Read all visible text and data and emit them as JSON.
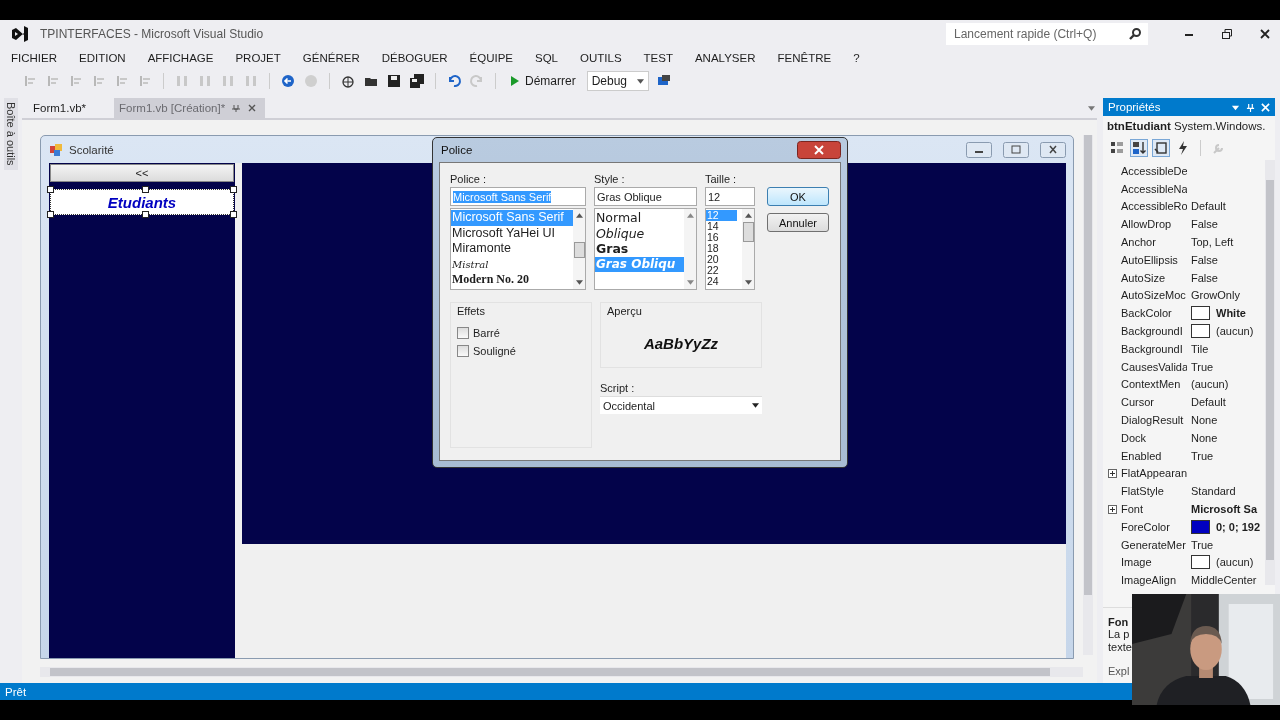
{
  "window": {
    "title": "TPINTERFACES - Microsoft Visual Studio",
    "quick_launch": {
      "placeholder": "Lancement rapide (Ctrl+Q)"
    }
  },
  "menu": [
    "FICHIER",
    "EDITION",
    "AFFICHAGE",
    "PROJET",
    "GÉNÉRER",
    "DÉBOGUER",
    "ÉQUIPE",
    "SQL",
    "OUTILS",
    "TEST",
    "ANALYSER",
    "FENÊTRE",
    "?"
  ],
  "toolbar": {
    "run_label": "Démarrer",
    "configuration": "Debug"
  },
  "toolbox_tab": "Boîte à outils",
  "document_tabs": [
    {
      "label": "Form1.vb*",
      "selected": false
    },
    {
      "label": "Form1.vb [Création]*",
      "selected": true
    }
  ],
  "form": {
    "title": "Scolarité",
    "buttons": [
      {
        "label": "<<",
        "selected": false
      },
      {
        "label": "Etudiants",
        "selected": true
      }
    ]
  },
  "font_dialog": {
    "title": "Police",
    "font": {
      "label": "Police :",
      "value": "Microsoft Sans Serif",
      "items": [
        {
          "label": "Microsoft Sans Serif",
          "kind": "sans",
          "selected": true
        },
        {
          "label": "Microsoft YaHei UI",
          "kind": "sans",
          "selected": false
        },
        {
          "label": "Miramonte",
          "kind": "sans",
          "selected": false
        },
        {
          "label": "Mistral",
          "kind": "script",
          "selected": false
        },
        {
          "label": "Modern No. 20",
          "kind": "serif",
          "selected": false
        }
      ]
    },
    "style": {
      "label": "Style :",
      "value": "Gras Oblique",
      "items": [
        {
          "label": "Normal",
          "kind": "normal",
          "selected": false
        },
        {
          "label": "Oblique",
          "kind": "italic",
          "selected": false
        },
        {
          "label": "Gras",
          "kind": "bold",
          "selected": false
        },
        {
          "label": "Gras Obliqu",
          "kind": "bolditalic",
          "selected": true
        }
      ]
    },
    "size": {
      "label": "Taille :",
      "value": "12",
      "items": [
        {
          "label": "12",
          "selected": true
        },
        {
          "label": "14",
          "selected": false
        },
        {
          "label": "16",
          "selected": false
        },
        {
          "label": "18",
          "selected": false
        },
        {
          "label": "20",
          "selected": false
        },
        {
          "label": "22",
          "selected": false
        },
        {
          "label": "24",
          "selected": false
        }
      ]
    },
    "effects": {
      "title": "Effets",
      "options": [
        {
          "label": "Barré",
          "checked": false
        },
        {
          "label": "Souligné",
          "checked": false
        }
      ]
    },
    "preview": {
      "title": "Aperçu",
      "sample": "AaBbYyZz"
    },
    "script": {
      "label": "Script :",
      "value": "Occidental"
    },
    "buttons": [
      "OK",
      "Annuler"
    ]
  },
  "properties": {
    "title": "Propriétés",
    "object_name": "btnEtudiant",
    "object_type": "System.Windows.",
    "rows": [
      {
        "name": "AccessibleDe",
        "expandable": false
      },
      {
        "name": "AccessibleNa",
        "expandable": false
      },
      {
        "name": "AccessibleRo",
        "value": "Default",
        "modified": false,
        "expandable": false
      },
      {
        "name": "AllowDrop",
        "value": "False",
        "modified": false,
        "expandable": false
      },
      {
        "name": "Anchor",
        "value": "Top, Left",
        "modified": false,
        "expandable": false
      },
      {
        "name": "AutoEllipsis",
        "value": "False",
        "modified": false,
        "expandable": false
      },
      {
        "name": "AutoSize",
        "value": "False",
        "modified": false,
        "expandable": false
      },
      {
        "name": "AutoSizeMoc",
        "value": "GrowOnly",
        "modified": false,
        "expandable": false
      },
      {
        "name": "BackColor",
        "value": "White",
        "color": "#ffffff",
        "modified": true,
        "expandable": false
      },
      {
        "name": "BackgroundI",
        "value": "(aucun)",
        "color": "#ffffff",
        "modified": false,
        "expandable": false
      },
      {
        "name": "BackgroundI",
        "value": "Tile",
        "modified": false,
        "expandable": false
      },
      {
        "name": "CausesValida",
        "value": "True",
        "modified": false,
        "expandable": false
      },
      {
        "name": "ContextMen",
        "value": "(aucun)",
        "modified": false,
        "expandable": false
      },
      {
        "name": "Cursor",
        "value": "Default",
        "modified": false,
        "expandable": false
      },
      {
        "name": "DialogResult",
        "value": "None",
        "modified": false,
        "expandable": false
      },
      {
        "name": "Dock",
        "value": "None",
        "modified": false,
        "expandable": false
      },
      {
        "name": "Enabled",
        "value": "True",
        "modified": false,
        "expandable": false
      },
      {
        "name": "FlatAppearan",
        "expandable": true
      },
      {
        "name": "FlatStyle",
        "value": "Standard",
        "modified": false,
        "expandable": false
      },
      {
        "name": "Font",
        "value": "Microsoft Sa",
        "modified": true,
        "expandable": true
      },
      {
        "name": "ForeColor",
        "value": "0; 0; 192",
        "color": "#0000c0",
        "modified": true,
        "expandable": false
      },
      {
        "name": "GenerateMer",
        "value": "True",
        "modified": false,
        "expandable": false
      },
      {
        "name": "Image",
        "value": "(aucun)",
        "color": "#ffffff",
        "modified": false,
        "expandable": false
      },
      {
        "name": "ImageAlign",
        "value": "MiddleCenter",
        "modified": false,
        "expandable": false
      }
    ],
    "description": {
      "title": "Fon",
      "lines": [
        "La p",
        "texte"
      ]
    },
    "footer": "Expl"
  },
  "status_bar": "Prêt"
}
